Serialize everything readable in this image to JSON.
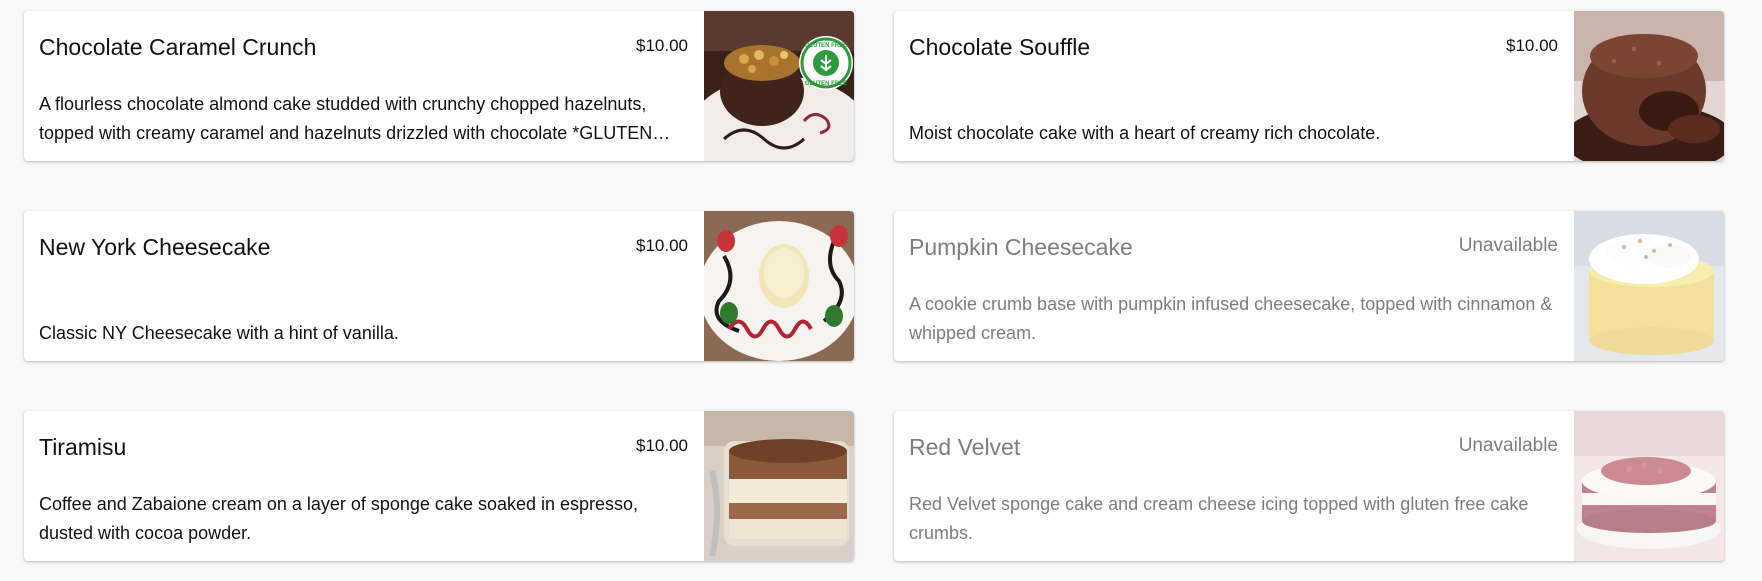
{
  "items": [
    {
      "name": "Chocolate Caramel Crunch",
      "price": "$10.00",
      "description": "A flourless chocolate almond cake studded with crunchy chopped hazelnuts, topped with creamy caramel and hazelnuts drizzled with chocolate *GLUTEN FREE*",
      "available": true,
      "image": "chocolate-caramel-crunch-photo",
      "badge": "GLUTEN FREE"
    },
    {
      "name": "Chocolate Souffle",
      "price": "$10.00",
      "description": "Moist chocolate cake with a heart of creamy rich chocolate.",
      "available": true,
      "image": "chocolate-souffle-photo"
    },
    {
      "name": "New York Cheesecake",
      "price": "$10.00",
      "description": "Classic NY Cheesecake with a hint of vanilla.",
      "available": true,
      "image": "new-york-cheesecake-photo"
    },
    {
      "name": "Pumpkin Cheesecake",
      "price": "Unavailable",
      "description": "A cookie crumb base with pumpkin infused cheesecake, topped with cinnamon & whipped cream.",
      "available": false,
      "image": "pumpkin-cheesecake-photo"
    },
    {
      "name": "Tiramisu",
      "price": "$10.00",
      "description": "Coffee and Zabaione cream on a layer of sponge cake soaked in espresso, dusted with cocoa powder.",
      "available": true,
      "image": "tiramisu-photo"
    },
    {
      "name": "Red Velvet",
      "price": "Unavailable",
      "description": "Red Velvet sponge cake and cream cheese icing topped with gluten free cake crumbs.",
      "available": false,
      "image": "red-velvet-photo"
    }
  ]
}
